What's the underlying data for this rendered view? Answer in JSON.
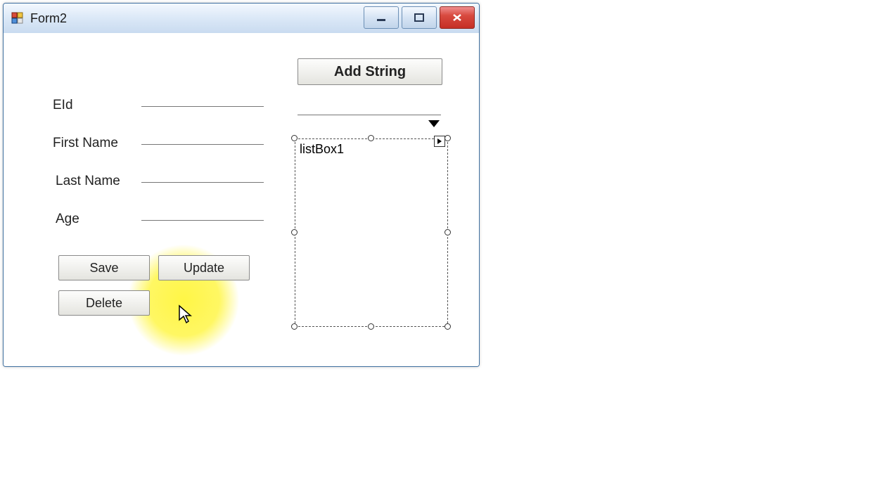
{
  "window": {
    "title": "Form2"
  },
  "fields": {
    "eid_label": "EId",
    "first_name_label": "First Name",
    "last_name_label": "Last Name",
    "age_label": "Age",
    "eid_value": "",
    "first_name_value": "",
    "last_name_value": "",
    "age_value": ""
  },
  "buttons": {
    "save": "Save",
    "update": "Update",
    "delete": "Delete",
    "add_string": "Add String"
  },
  "combo": {
    "selected": ""
  },
  "listbox": {
    "placeholder": "listBox1",
    "items": []
  }
}
